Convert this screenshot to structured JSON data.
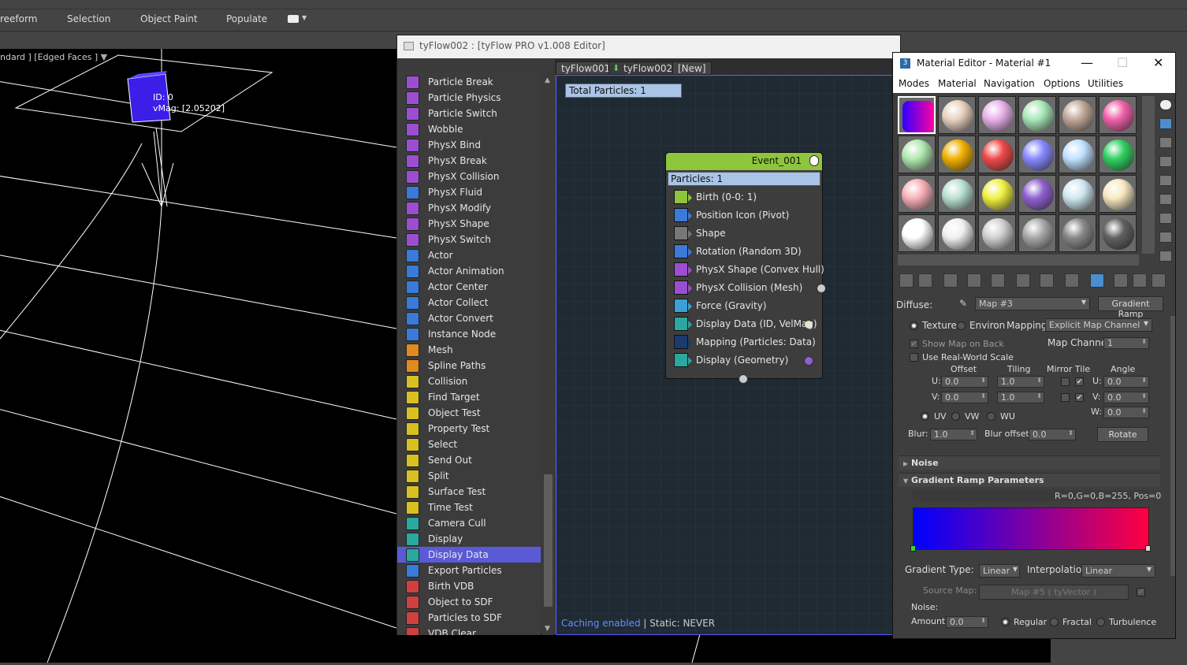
{
  "ribbon": {
    "tabs": [
      "reeform",
      "Selection",
      "Object Paint",
      "Populate"
    ]
  },
  "viewport": {
    "label": "ndard ] [Edged Faces ]",
    "particle_id": "ID: 0",
    "particle_vmag": "vMag: [2.05202]"
  },
  "tyflow": {
    "title": "tyFlow002 : [tyFlow PRO v1.008 Editor]",
    "tabs": [
      "tyFlow001",
      "tyFlow002",
      "[New]"
    ],
    "total_particles": "Total Particles: 1",
    "cache_enabled": "Caching enabled",
    "cache_static": " | Static: NEVER",
    "operators": [
      {
        "label": "Particle Break",
        "color": "#9b4fd0"
      },
      {
        "label": "Particle Physics",
        "color": "#9b4fd0"
      },
      {
        "label": "Particle Switch",
        "color": "#9b4fd0"
      },
      {
        "label": "Wobble",
        "color": "#9b4fd0"
      },
      {
        "label": "PhysX Bind",
        "color": "#9b4fd0"
      },
      {
        "label": "PhysX Break",
        "color": "#9b4fd0"
      },
      {
        "label": "PhysX Collision",
        "color": "#9b4fd0"
      },
      {
        "label": "PhysX Fluid",
        "color": "#3a7ad8"
      },
      {
        "label": "PhysX Modify",
        "color": "#9b4fd0"
      },
      {
        "label": "PhysX Shape",
        "color": "#9b4fd0"
      },
      {
        "label": "PhysX Switch",
        "color": "#9b4fd0"
      },
      {
        "label": "Actor",
        "color": "#3a7ad8"
      },
      {
        "label": "Actor Animation",
        "color": "#3a7ad8"
      },
      {
        "label": "Actor Center",
        "color": "#3a7ad8"
      },
      {
        "label": "Actor Collect",
        "color": "#3a7ad8"
      },
      {
        "label": "Actor Convert",
        "color": "#3a7ad8"
      },
      {
        "label": "Instance Node",
        "color": "#3a7ad8"
      },
      {
        "label": "Mesh",
        "color": "#e08a20"
      },
      {
        "label": "Spline Paths",
        "color": "#e08a20"
      },
      {
        "label": "Collision",
        "color": "#d8c020"
      },
      {
        "label": "Find Target",
        "color": "#d8c020"
      },
      {
        "label": "Object Test",
        "color": "#d8c020"
      },
      {
        "label": "Property Test",
        "color": "#d8c020"
      },
      {
        "label": "Select",
        "color": "#d8c020"
      },
      {
        "label": "Send Out",
        "color": "#d8c020"
      },
      {
        "label": "Split",
        "color": "#d8c020"
      },
      {
        "label": "Surface Test",
        "color": "#d8c020"
      },
      {
        "label": "Time Test",
        "color": "#d8c020"
      },
      {
        "label": "Camera Cull",
        "color": "#2aa8a0"
      },
      {
        "label": "Display",
        "color": "#2aa8a0"
      },
      {
        "label": "Display Data",
        "color": "#2aa8a0"
      },
      {
        "label": "Export Particles",
        "color": "#3a7ad8"
      },
      {
        "label": "Birth VDB",
        "color": "#d04040"
      },
      {
        "label": "Object to SDF",
        "color": "#d04040"
      },
      {
        "label": "Particles to SDF",
        "color": "#d04040"
      },
      {
        "label": "VDB Clear",
        "color": "#d04040"
      }
    ],
    "event": {
      "name": "Event_001",
      "particles": "Particles: 1",
      "ops": [
        {
          "label": "Birth (0-0: 1)",
          "color": "#8ec53c"
        },
        {
          "label": "Position Icon (Pivot)",
          "color": "#3a7ad8"
        },
        {
          "label": "Shape",
          "color": "#777777"
        },
        {
          "label": "Rotation (Random 3D)",
          "color": "#3a7ad8"
        },
        {
          "label": "PhysX Shape (Convex Hull)",
          "color": "#9b4fd0"
        },
        {
          "label": "PhysX Collision (Mesh)",
          "color": "#9b4fd0"
        },
        {
          "label": "Force (Gravity)",
          "color": "#3aa0d8"
        },
        {
          "label": "Display Data (ID, VelMag)",
          "color": "#2aa8a0"
        },
        {
          "label": "Mapping (Particles: Data)",
          "color": "#1a3a70"
        },
        {
          "label": "Display (Geometry)",
          "color": "#2aa8a0"
        }
      ]
    }
  },
  "material_editor": {
    "title": "Material Editor - Material #1",
    "menu": [
      "Modes",
      "Material",
      "Navigation",
      "Options",
      "Utilities"
    ],
    "slot_colors": [
      "#7a18ff",
      "#e8d2c0",
      "#e8b0e8",
      "#a8e8b8",
      "#c0a898",
      "#f060a8",
      "#b0e8b0",
      "#f0b000",
      "#f04848",
      "#8888ff",
      "#c0e0ff",
      "#30d060",
      "#f8b0b8",
      "#b8e0d0",
      "#f0f040",
      "#9060d0",
      "#d0e8f0",
      "#f8e8c0",
      "#ffffff",
      "#f0f0f0",
      "#d0d0d0",
      "#a8a8a8",
      "#888888",
      "#606060"
    ],
    "diffuse_label": "Diffuse:",
    "map_name": "Map #3",
    "map_type": "Gradient Ramp",
    "coords": {
      "texture": "Texture",
      "environ": "Environ",
      "mapping_label": "Mapping:",
      "mapping_value": "Explicit Map Channel",
      "show_map_on_back": "Show Map on Back",
      "map_channel_label": "Map Channel:",
      "map_channel_value": "1",
      "use_real_world": "Use Real-World Scale",
      "offset": "Offset",
      "tiling": "Tiling",
      "mirror_tile": "Mirror Tile",
      "angle": "Angle",
      "u_label": "U:",
      "v_label": "V:",
      "w_label": "W:",
      "u_offset": "0.0",
      "v_offset": "0.0",
      "u_tiling": "1.0",
      "v_tiling": "1.0",
      "u_angle": "0.0",
      "v_angle": "0.0",
      "w_angle": "0.0",
      "uv": "UV",
      "vw": "VW",
      "wu": "WU",
      "blur_label": "Blur:",
      "blur_value": "1.0",
      "blur_offset_label": "Blur offset:",
      "blur_offset_value": "0.0",
      "rotate": "Rotate"
    },
    "noise_rollout": "Noise",
    "gradient_rollout": "Gradient Ramp Parameters",
    "gradient_coords": "R=0,G=0,B=255, Pos=0",
    "gradient_type_label": "Gradient Type:",
    "gradient_type_value": "Linear",
    "interpolation_label": "Interpolation:",
    "interpolation_value": "Linear",
    "source_map_label": "Source Map:",
    "source_map_value": "Map #5 ( tyVector )",
    "noise_label": "Noise:",
    "amount_label": "Amount:",
    "amount_value": "0.0",
    "regular": "Regular",
    "fractal": "Fractal",
    "turbulence": "Turbulence"
  }
}
